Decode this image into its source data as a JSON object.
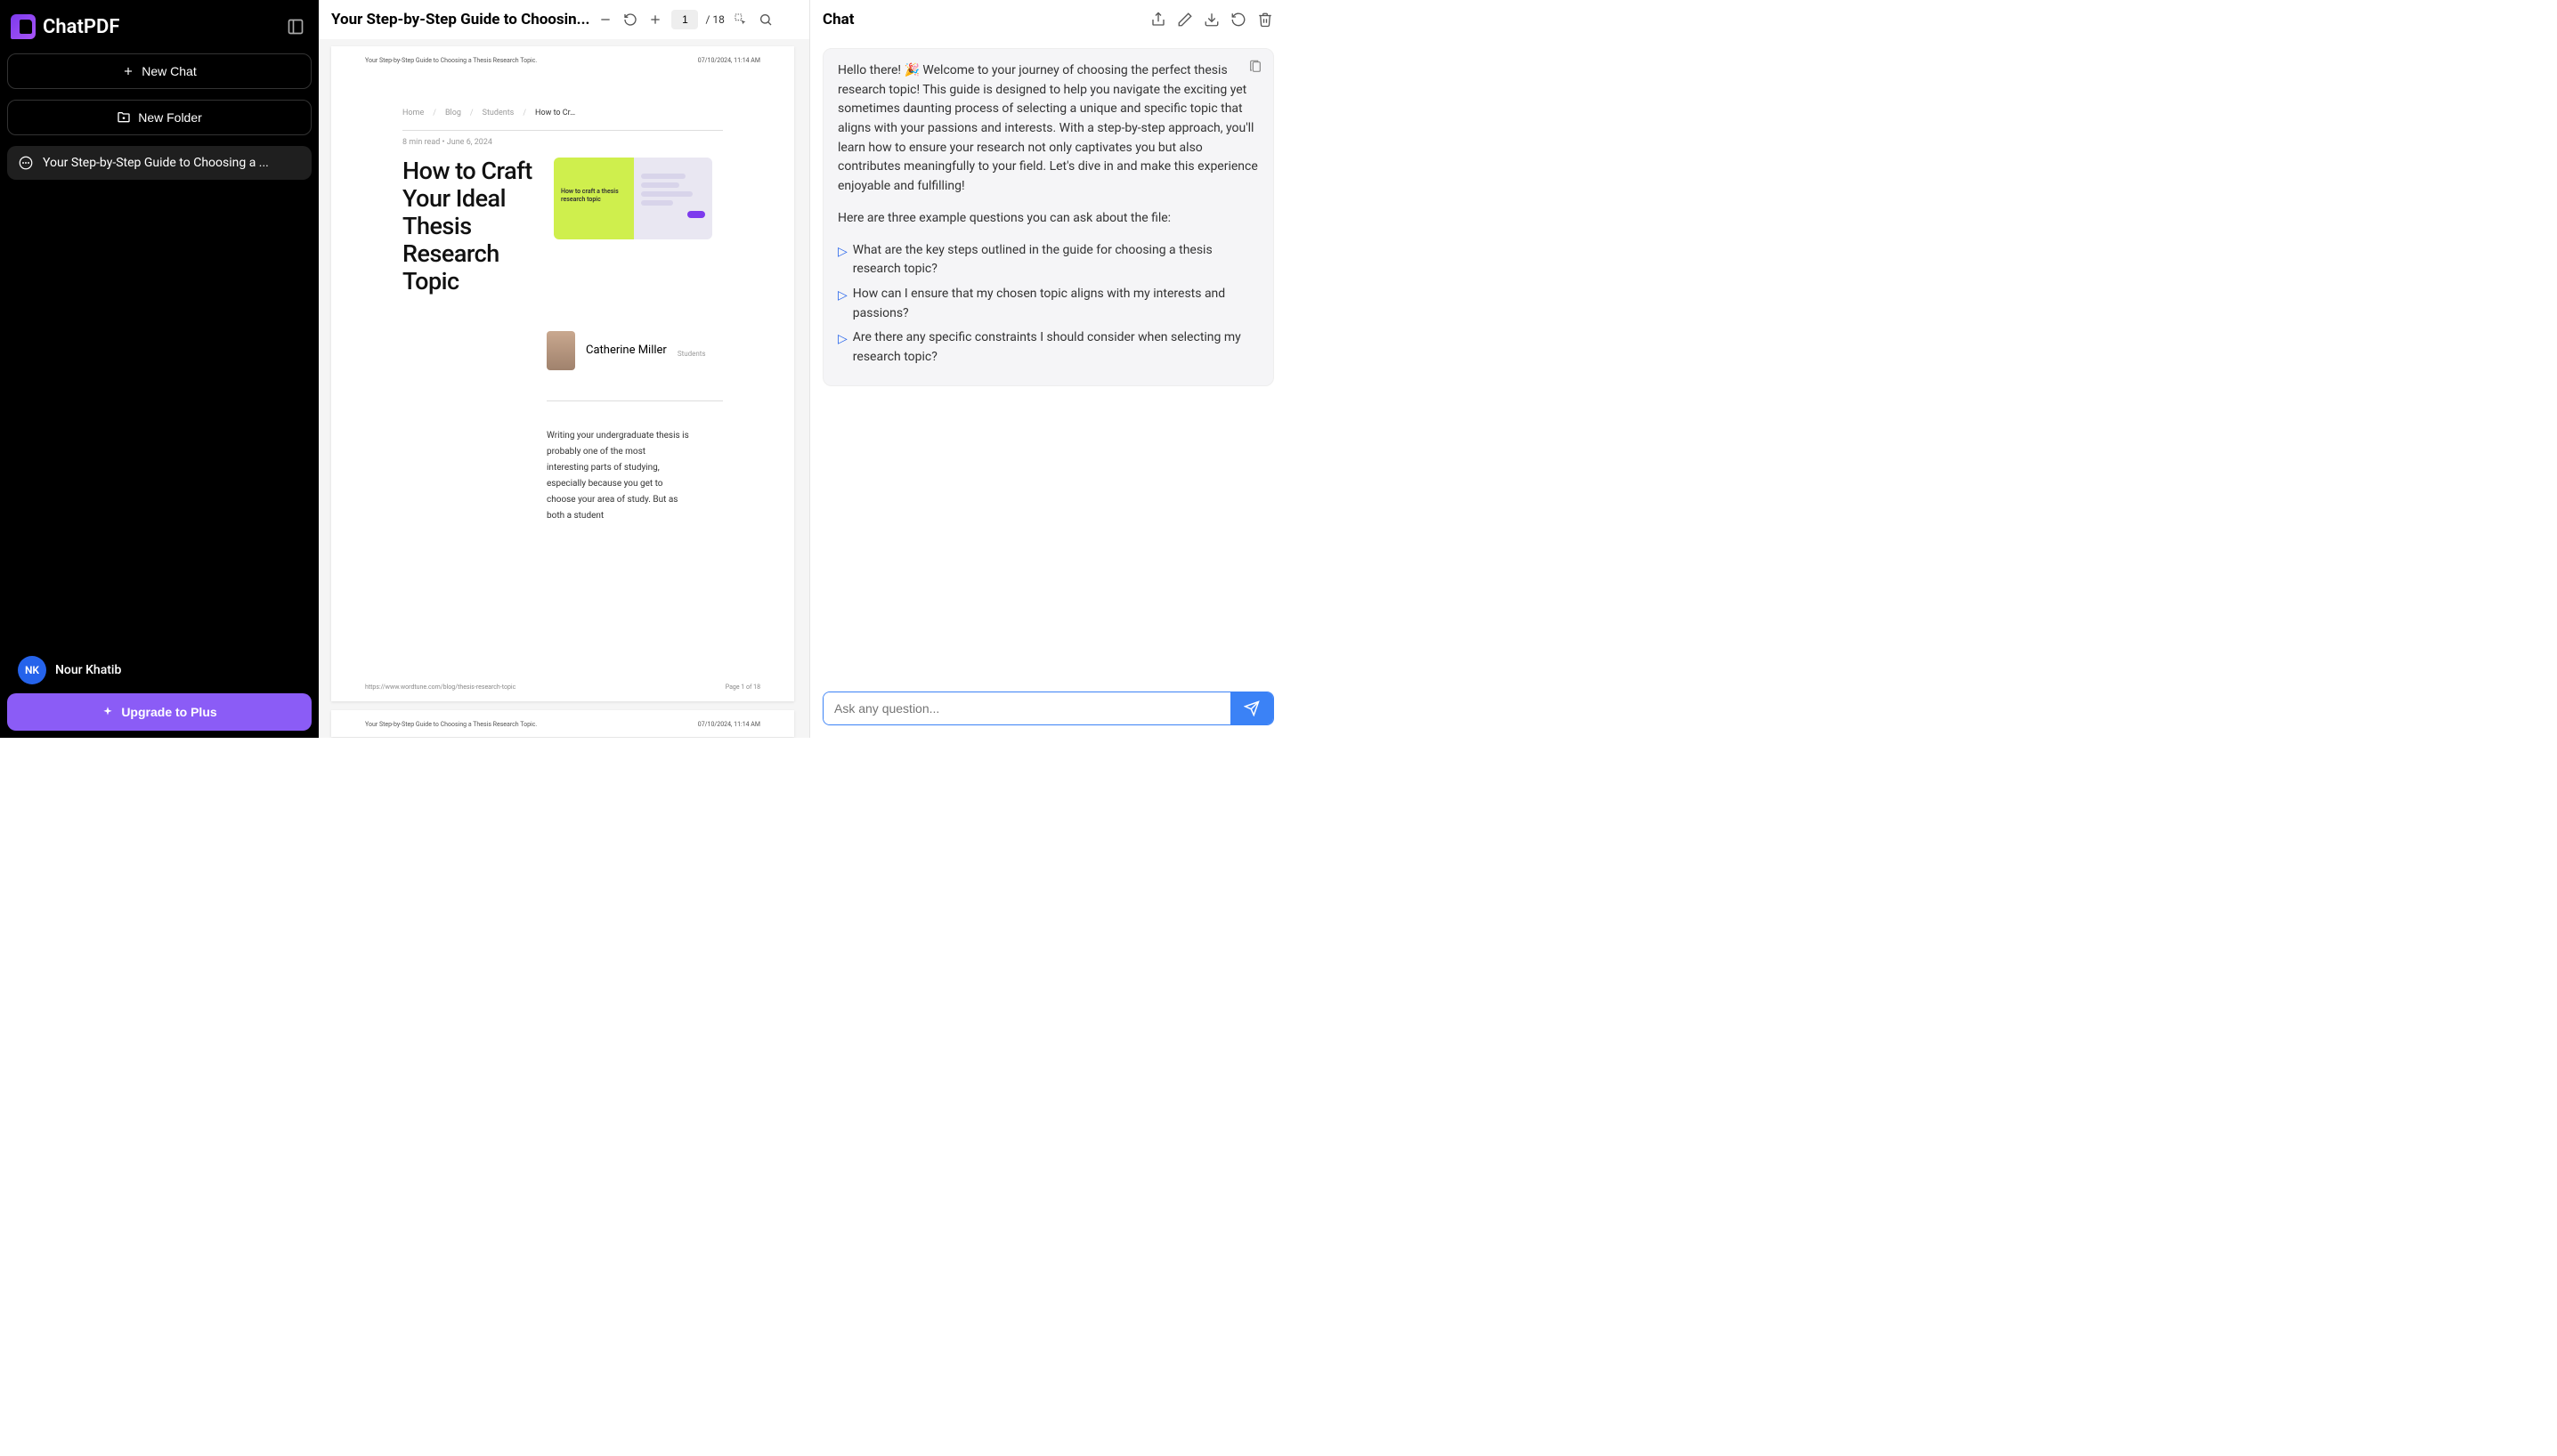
{
  "sidebar": {
    "brand": "ChatPDF",
    "new_chat_label": "New Chat",
    "new_folder_label": "New Folder",
    "active_chat": "Your Step-by-Step Guide to Choosing a ...",
    "user": {
      "initials": "NK",
      "name": "Nour Khatib"
    },
    "upgrade_label": "Upgrade to Plus"
  },
  "pdf": {
    "toolbar_title": "Your Step-by-Step Guide to Choosin...",
    "current_page": "1",
    "total_pages": "/ 18",
    "page_header_title": "Your Step-by-Step Guide to Choosing a Thesis Research Topic.",
    "page_header_date": "07/10/2024, 11:14 AM",
    "breadcrumbs": [
      "Home",
      "Blog",
      "Students",
      "How to Cr…"
    ],
    "meta": "8 min read   •   June 6, 2024",
    "heading": "How to Craft Your Ideal Thesis Research Topic",
    "card_caption": "How to craft a thesis research topic",
    "author_name": "Catherine Miller",
    "author_role": "Students",
    "body": "Writing your undergraduate thesis is probably one of the most interesting parts of studying, especially because you get to choose your area of study. But as both a student",
    "footer_url": "https://www.wordtune.com/blog/thesis-research-topic",
    "footer_page": "Page 1 of 18"
  },
  "chat": {
    "title": "Chat",
    "welcome": "Hello there! 🎉 Welcome to your journey of choosing the perfect thesis research topic! This guide is designed to help you navigate the exciting yet sometimes daunting process of selecting a unique and specific topic that aligns with your passions and interests. With a step-by-step approach, you'll learn how to ensure your research not only captivates you but also contributes meaningfully to your field. Let's dive in and make this experience enjoyable and fulfilling!",
    "examples_intro": "Here are three example questions you can ask about the file:",
    "suggestions": [
      "What are the key steps outlined in the guide for choosing a thesis research topic?",
      "How can I ensure that my chosen topic aligns with my interests and passions?",
      "Are there any specific constraints I should consider when selecting my research topic?"
    ],
    "input_placeholder": "Ask any question..."
  }
}
